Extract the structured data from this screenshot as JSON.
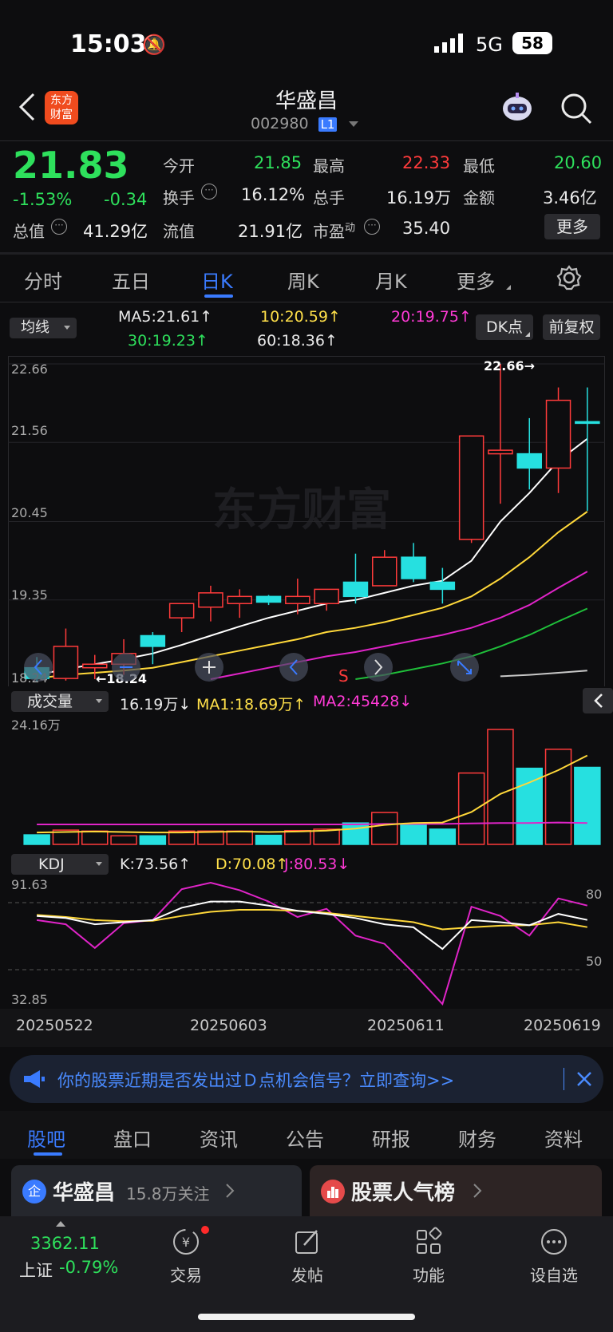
{
  "status_bar": {
    "time": "15:03",
    "network": "5G",
    "battery": "58"
  },
  "header": {
    "title": "华盛昌",
    "code": "002980",
    "level_badge": "L1",
    "logo_line1": "东方",
    "logo_line2": "财富"
  },
  "quote": {
    "price": "21.83",
    "change_pct": "-1.53%",
    "change": "-0.34",
    "open_label": "今开",
    "open": "21.85",
    "high_label": "最高",
    "high": "22.33",
    "low_label": "最低",
    "low": "20.60",
    "turnover_label": "换手",
    "turnover": "16.12%",
    "volume_label": "总手",
    "volume": "16.19万",
    "amount_label": "金额",
    "amount": "3.46亿",
    "mktcap_label": "总值",
    "mktcap": "41.29亿",
    "float_label": "流值",
    "float": "21.91亿",
    "pe_label": "市盈",
    "pe_sup": "动",
    "pe": "35.40",
    "more_button": "更多"
  },
  "period_tabs": [
    "分时",
    "五日",
    "日K",
    "周K",
    "月K",
    "更多"
  ],
  "active_tab": "日K",
  "ma_bar": {
    "selector": "均线",
    "ma5": "MA5:21.61↑",
    "ma10": "10:20.59↑",
    "ma20": "20:19.75↑",
    "ma30": "30:19.23↑",
    "ma60": "60:18.36↑",
    "dk_button": "DK点",
    "fq_button": "前复权"
  },
  "price_axis": {
    "top": "22.66",
    "l2": "21.56",
    "l3": "20.45",
    "l4": "19.35",
    "bottom": "18.24"
  },
  "annotations": {
    "max_label": "22.66→",
    "min_label": "←18.24",
    "s_marker": "S",
    "watermark": "东方财富"
  },
  "volume_bar": {
    "selector": "成交量",
    "vol": "16.19万↓",
    "ma1": "MA1:18.69万↑",
    "ma2": "MA2:45428↓",
    "axis_top": "24.16万"
  },
  "kdj_bar": {
    "selector": "KDJ",
    "k": "K:73.56↑",
    "d": "D:70.08↑",
    "j": "J:80.53↓",
    "axis_top": "91.63",
    "axis_bottom": "32.85",
    "level80": "80",
    "level50": "50"
  },
  "dates": [
    "20250522",
    "20250603",
    "20250611",
    "20250619"
  ],
  "banner": {
    "text": "你的股票近期是否发出过Ｄ点机会信号？立即查询>>"
  },
  "bottom_tabs": [
    "股吧",
    "盘口",
    "资讯",
    "公告",
    "研报",
    "财务",
    "资料"
  ],
  "active_bottom_tab": "股吧",
  "cards": {
    "stock_name": "华盛昌",
    "followers": "15.8万关注",
    "ranking": "股票人气榜"
  },
  "index": {
    "value": "3362.11",
    "name": "上证",
    "change": "-0.79%"
  },
  "nav": [
    "交易",
    "发帖",
    "功能",
    "设自选"
  ],
  "colors": {
    "up": "#ff3b3b",
    "down": "#26e0e0",
    "accent": "#3a7bff"
  },
  "chart_data": {
    "type": "candlestick",
    "ylim": [
      18.24,
      22.66
    ],
    "candles": [
      {
        "o": 18.4,
        "h": 18.55,
        "l": 18.2,
        "c": 18.25
      },
      {
        "o": 18.25,
        "h": 18.95,
        "l": 18.22,
        "c": 18.7
      },
      {
        "o": 18.4,
        "h": 18.58,
        "l": 18.24,
        "c": 18.45
      },
      {
        "o": 18.45,
        "h": 18.8,
        "l": 18.3,
        "c": 18.6
      },
      {
        "o": 18.85,
        "h": 18.9,
        "l": 18.45,
        "c": 18.7
      },
      {
        "o": 19.1,
        "h": 19.25,
        "l": 18.9,
        "c": 19.3
      },
      {
        "o": 19.25,
        "h": 19.55,
        "l": 19.05,
        "c": 19.45
      },
      {
        "o": 19.3,
        "h": 19.5,
        "l": 19.1,
        "c": 19.4
      },
      {
        "o": 19.4,
        "h": 19.42,
        "l": 19.28,
        "c": 19.32
      },
      {
        "o": 19.3,
        "h": 19.65,
        "l": 19.15,
        "c": 19.4
      },
      {
        "o": 19.3,
        "h": 19.5,
        "l": 19.2,
        "c": 19.5
      },
      {
        "o": 19.6,
        "h": 20.0,
        "l": 19.3,
        "c": 19.4
      },
      {
        "o": 19.55,
        "h": 20.05,
        "l": 19.55,
        "c": 19.95
      },
      {
        "o": 19.95,
        "h": 20.15,
        "l": 19.6,
        "c": 19.65
      },
      {
        "o": 19.6,
        "h": 19.8,
        "l": 19.3,
        "c": 19.5
      },
      {
        "o": 20.2,
        "h": 21.65,
        "l": 20.15,
        "c": 21.65
      },
      {
        "o": 21.4,
        "h": 22.66,
        "l": 20.7,
        "c": 21.45
      },
      {
        "o": 21.4,
        "h": 21.9,
        "l": 20.9,
        "c": 21.2
      },
      {
        "o": 21.2,
        "h": 22.33,
        "l": 20.85,
        "c": 22.15
      },
      {
        "o": 21.85,
        "h": 22.33,
        "l": 20.6,
        "c": 21.83
      }
    ],
    "ma5": [
      18.3,
      18.38,
      18.45,
      18.52,
      18.6,
      18.72,
      18.85,
      18.98,
      19.1,
      19.2,
      19.3,
      19.35,
      19.45,
      19.55,
      19.62,
      19.9,
      20.45,
      20.85,
      21.3,
      21.61
    ],
    "ma10": [
      18.25,
      18.3,
      18.33,
      18.36,
      18.4,
      18.48,
      18.56,
      18.64,
      18.72,
      18.8,
      18.9,
      18.96,
      19.04,
      19.14,
      19.24,
      19.4,
      19.65,
      19.95,
      20.3,
      20.59
    ],
    "ma20": [
      null,
      null,
      null,
      null,
      null,
      null,
      18.24,
      18.32,
      18.4,
      18.48,
      18.56,
      18.62,
      18.7,
      18.78,
      18.86,
      18.96,
      19.1,
      19.28,
      19.52,
      19.75
    ],
    "ma30": [
      null,
      null,
      null,
      null,
      null,
      null,
      null,
      null,
      null,
      null,
      null,
      18.24,
      18.3,
      18.38,
      18.46,
      18.56,
      18.7,
      18.86,
      19.05,
      19.23
    ],
    "ma60": [
      null,
      null,
      null,
      null,
      null,
      null,
      null,
      null,
      null,
      null,
      null,
      null,
      null,
      null,
      null,
      null,
      18.28,
      18.3,
      18.33,
      18.36
    ],
    "volume": [
      2.0,
      3.0,
      2.8,
      1.8,
      1.8,
      2.8,
      2.8,
      2.8,
      1.9,
      2.9,
      3.2,
      4.5,
      6.7,
      4.3,
      3.2,
      15.0,
      24.16,
      16.0,
      20.0,
      16.19
    ],
    "vol_ma1": [
      2.5,
      2.6,
      2.7,
      2.6,
      2.5,
      2.5,
      2.6,
      2.7,
      2.6,
      2.7,
      2.9,
      3.3,
      4.1,
      4.5,
      4.6,
      6.8,
      10.6,
      13.0,
      15.6,
      18.69
    ],
    "vol_ma2": [
      4.2,
      4.2,
      4.2,
      4.2,
      4.2,
      4.2,
      4.2,
      4.2,
      4.2,
      4.2,
      4.2,
      4.2,
      4.3,
      4.3,
      4.3,
      4.4,
      4.5,
      4.5,
      4.6,
      4.5
    ],
    "k": [
      75.5,
      74.5,
      71.5,
      72.5,
      73.5,
      79.5,
      82.5,
      82.5,
      80.5,
      78.0,
      76.5,
      74.5,
      71.5,
      70.0,
      59.5,
      73.5,
      72.5,
      71.0,
      76.5,
      73.56
    ],
    "d": [
      76.0,
      75.0,
      73.5,
      73.0,
      73.2,
      75.5,
      77.5,
      78.5,
      78.5,
      78.0,
      77.0,
      75.5,
      74.0,
      72.5,
      69.0,
      70.0,
      70.8,
      71.0,
      72.5,
      70.08
    ],
    "j": [
      73.5,
      71.5,
      60.0,
      72.0,
      73.5,
      88.5,
      91.63,
      88.0,
      82.5,
      75.0,
      79.0,
      66.0,
      62.0,
      48.0,
      32.85,
      80.0,
      75.5,
      66.0,
      84.0,
      80.53
    ]
  }
}
